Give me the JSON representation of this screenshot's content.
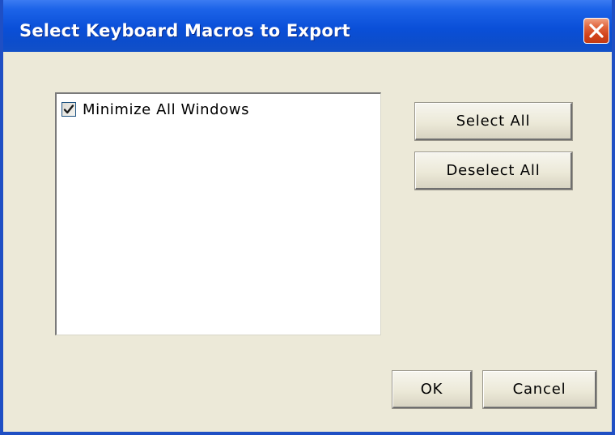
{
  "window": {
    "title": "Select Keyboard Macros to Export"
  },
  "icons": {
    "close": "close-icon",
    "check": "check-icon"
  },
  "macro_list": {
    "items": [
      {
        "label": "Minimize All Windows",
        "checked": true
      }
    ]
  },
  "buttons": {
    "select_all": "Select All",
    "deselect_all": "Deselect All",
    "ok": "OK",
    "cancel": "Cancel"
  },
  "colors": {
    "title_bar": "#0a4fd8",
    "window_face": "#ece9d8",
    "close_button": "#d2421a"
  }
}
